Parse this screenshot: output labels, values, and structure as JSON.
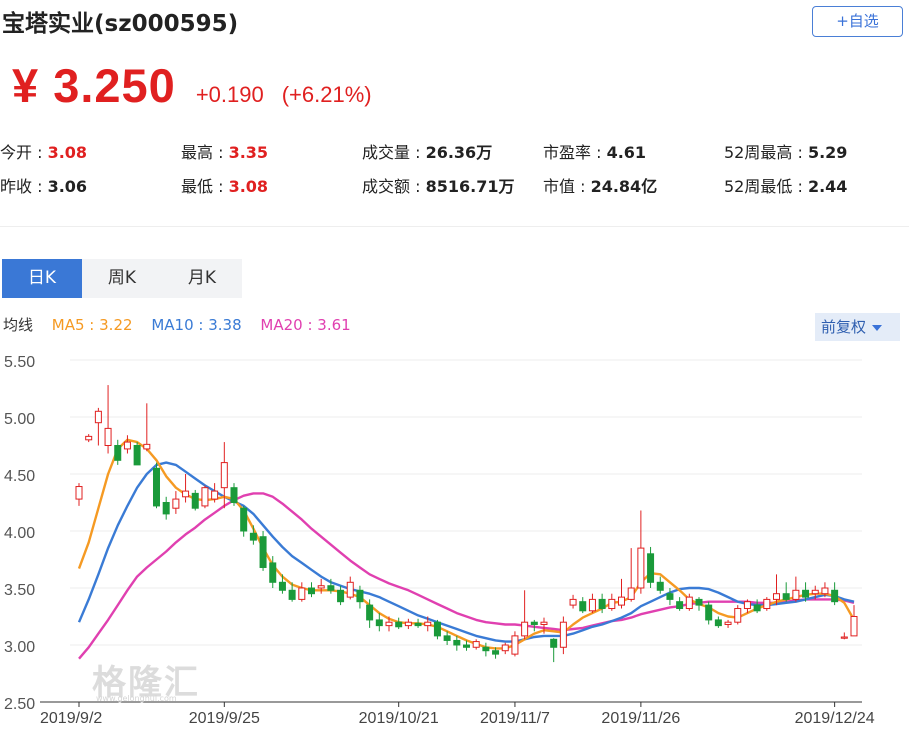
{
  "header": {
    "title": "宝塔实业(sz000595)",
    "watch_label": "+自选"
  },
  "quote": {
    "price": "¥ 3.250",
    "change": "+0.190",
    "change_pct": "(+6.21%)"
  },
  "stats": [
    {
      "label": "今开 : ",
      "value": "3.08",
      "red": true
    },
    {
      "label": "最高 : ",
      "value": "3.35",
      "red": true
    },
    {
      "label": "成交量 : ",
      "value": "26.36万",
      "red": false
    },
    {
      "label": "市盈率 : ",
      "value": "4.61",
      "red": false
    },
    {
      "label": "52周最高 : ",
      "value": "5.29",
      "red": false
    },
    {
      "label": "昨收 : ",
      "value": "3.06",
      "red": false
    },
    {
      "label": "最低 : ",
      "value": "3.08",
      "red": true
    },
    {
      "label": "成交额 : ",
      "value": "8516.71万",
      "red": false
    },
    {
      "label": "市值 : ",
      "value": "24.84亿",
      "red": false
    },
    {
      "label": "52周最低 : ",
      "value": "2.44",
      "red": false
    }
  ],
  "tabs": [
    {
      "label": "日K",
      "active": true
    },
    {
      "label": "周K",
      "active": false
    },
    {
      "label": "月K",
      "active": false
    }
  ],
  "legend": {
    "label": "均线",
    "ma5": "MA5 : 3.22",
    "ma10": "MA10 : 3.38",
    "ma20": "MA20 : 3.61"
  },
  "adjust_label": "前复权",
  "watermark": "格隆汇",
  "watermark_sub": "www.gelonghui.com",
  "colors": {
    "up": "#e02020",
    "down": "#1a9a3a",
    "ma5": "#f59a23",
    "ma10": "#3a7bd5",
    "ma20": "#e040b0",
    "accent": "#3a78d6"
  },
  "chart_data": {
    "type": "candlestick",
    "ylim": [
      2.5,
      5.5
    ],
    "yticks": [
      "5.50",
      "5.00",
      "4.50",
      "4.00",
      "3.50",
      "3.00",
      "2.50"
    ],
    "xticks": [
      {
        "index": 0,
        "label": "2019/9/2"
      },
      {
        "index": 15,
        "label": "2019/9/25"
      },
      {
        "index": 33,
        "label": "2019/10/21"
      },
      {
        "index": 45,
        "label": "2019/11/7"
      },
      {
        "index": 58,
        "label": "2019/11/26"
      },
      {
        "index": 78,
        "label": "2019/12/24"
      }
    ],
    "candles": [
      [
        4.28,
        4.39,
        4.22,
        4.42
      ],
      [
        4.8,
        4.83,
        4.78,
        4.85
      ],
      [
        4.95,
        5.05,
        4.75,
        5.08
      ],
      [
        4.75,
        4.9,
        4.68,
        5.28
      ],
      [
        4.75,
        4.62,
        4.58,
        4.8
      ],
      [
        4.72,
        4.78,
        4.68,
        4.84
      ],
      [
        4.75,
        4.58,
        4.58,
        4.78
      ],
      [
        4.72,
        4.76,
        4.7,
        5.12
      ],
      [
        4.55,
        4.22,
        4.2,
        4.6
      ],
      [
        4.25,
        4.15,
        4.1,
        4.3
      ],
      [
        4.2,
        4.28,
        4.15,
        4.35
      ],
      [
        4.3,
        4.35,
        4.25,
        4.5
      ],
      [
        4.33,
        4.2,
        4.18,
        4.36
      ],
      [
        4.22,
        4.38,
        4.2,
        4.4
      ],
      [
        4.28,
        4.35,
        4.25,
        4.42
      ],
      [
        4.38,
        4.6,
        4.2,
        4.78
      ],
      [
        4.38,
        4.25,
        4.22,
        4.42
      ],
      [
        4.2,
        4.0,
        3.95,
        4.22
      ],
      [
        3.98,
        3.92,
        3.88,
        4.05
      ],
      [
        3.95,
        3.68,
        3.65,
        4.0
      ],
      [
        3.72,
        3.55,
        3.5,
        3.78
      ],
      [
        3.55,
        3.48,
        3.45,
        3.62
      ],
      [
        3.48,
        3.4,
        3.38,
        3.55
      ],
      [
        3.4,
        3.5,
        3.38,
        3.55
      ],
      [
        3.5,
        3.45,
        3.42,
        3.55
      ],
      [
        3.5,
        3.52,
        3.45,
        3.58
      ],
      [
        3.52,
        3.48,
        3.45,
        3.58
      ],
      [
        3.48,
        3.38,
        3.35,
        3.52
      ],
      [
        3.42,
        3.55,
        3.4,
        3.6
      ],
      [
        3.48,
        3.38,
        3.32,
        3.52
      ],
      [
        3.35,
        3.22,
        3.15,
        3.4
      ],
      [
        3.22,
        3.17,
        3.12,
        3.28
      ],
      [
        3.17,
        3.2,
        3.12,
        3.25
      ],
      [
        3.2,
        3.16,
        3.14,
        3.24
      ],
      [
        3.17,
        3.2,
        3.14,
        3.23
      ],
      [
        3.19,
        3.17,
        3.15,
        3.23
      ],
      [
        3.17,
        3.2,
        3.12,
        3.25
      ],
      [
        3.2,
        3.08,
        3.05,
        3.22
      ],
      [
        3.08,
        3.04,
        3.0,
        3.12
      ],
      [
        3.04,
        3.0,
        2.95,
        3.08
      ],
      [
        3.0,
        2.98,
        2.95,
        3.04
      ],
      [
        2.98,
        3.03,
        2.96,
        3.05
      ],
      [
        2.98,
        2.95,
        2.9,
        3.02
      ],
      [
        2.95,
        2.92,
        2.88,
        2.98
      ],
      [
        2.95,
        3.0,
        2.92,
        3.02
      ],
      [
        2.92,
        3.08,
        2.9,
        3.12
      ],
      [
        3.08,
        3.2,
        3.05,
        3.48
      ],
      [
        3.2,
        3.18,
        3.12,
        3.22
      ],
      [
        3.18,
        3.2,
        3.1,
        3.24
      ],
      [
        3.05,
        2.98,
        2.85,
        3.06
      ],
      [
        2.98,
        3.2,
        2.92,
        3.25
      ],
      [
        3.35,
        3.4,
        3.32,
        3.44
      ],
      [
        3.38,
        3.3,
        3.28,
        3.42
      ],
      [
        3.3,
        3.4,
        3.28,
        3.45
      ],
      [
        3.4,
        3.32,
        3.28,
        3.45
      ],
      [
        3.32,
        3.4,
        3.3,
        3.45
      ],
      [
        3.35,
        3.42,
        3.32,
        3.58
      ],
      [
        3.4,
        3.5,
        3.38,
        3.85
      ],
      [
        3.5,
        3.85,
        3.45,
        4.18
      ],
      [
        3.8,
        3.55,
        3.5,
        3.86
      ],
      [
        3.55,
        3.48,
        3.45,
        3.6
      ],
      [
        3.45,
        3.4,
        3.35,
        3.5
      ],
      [
        3.38,
        3.32,
        3.3,
        3.42
      ],
      [
        3.32,
        3.42,
        3.3,
        3.45
      ],
      [
        3.4,
        3.35,
        3.3,
        3.42
      ],
      [
        3.35,
        3.22,
        3.18,
        3.38
      ],
      [
        3.22,
        3.17,
        3.15,
        3.25
      ],
      [
        3.18,
        3.2,
        3.15,
        3.22
      ],
      [
        3.2,
        3.32,
        3.18,
        3.35
      ],
      [
        3.32,
        3.38,
        3.28,
        3.4
      ],
      [
        3.35,
        3.3,
        3.28,
        3.4
      ],
      [
        3.32,
        3.4,
        3.3,
        3.42
      ],
      [
        3.4,
        3.45,
        3.35,
        3.62
      ],
      [
        3.45,
        3.4,
        3.38,
        3.55
      ],
      [
        3.4,
        3.48,
        3.38,
        3.6
      ],
      [
        3.48,
        3.42,
        3.38,
        3.55
      ],
      [
        3.45,
        3.48,
        3.4,
        3.52
      ],
      [
        3.45,
        3.5,
        3.42,
        3.55
      ],
      [
        3.48,
        3.38,
        3.35,
        3.55
      ],
      [
        3.06,
        3.07,
        3.05,
        3.11
      ],
      [
        3.08,
        3.25,
        3.08,
        3.35
      ]
    ],
    "ma5": [
      3.67,
      3.9,
      4.2,
      4.5,
      4.72,
      4.8,
      4.78,
      4.72,
      4.62,
      4.48,
      4.38,
      4.32,
      4.28,
      4.27,
      4.28,
      4.3,
      4.28,
      4.18,
      4.02,
      3.85,
      3.7,
      3.6,
      3.53,
      3.5,
      3.48,
      3.48,
      3.48,
      3.47,
      3.45,
      3.42,
      3.35,
      3.28,
      3.23,
      3.2,
      3.19,
      3.19,
      3.18,
      3.16,
      3.12,
      3.08,
      3.04,
      3.01,
      2.98,
      2.97,
      2.97,
      3.0,
      3.05,
      3.1,
      3.13,
      3.12,
      3.11,
      3.18,
      3.24,
      3.28,
      3.32,
      3.37,
      3.38,
      3.42,
      3.55,
      3.63,
      3.62,
      3.55,
      3.48,
      3.4,
      3.36,
      3.33,
      3.28,
      3.25,
      3.24,
      3.28,
      3.32,
      3.35,
      3.38,
      3.4,
      3.42,
      3.44,
      3.45,
      3.45,
      3.43,
      3.37,
      3.22
    ],
    "ma10": [
      3.2,
      3.4,
      3.62,
      3.85,
      4.05,
      4.22,
      4.38,
      4.5,
      4.58,
      4.6,
      4.58,
      4.52,
      4.46,
      4.4,
      4.35,
      4.3,
      4.26,
      4.22,
      4.15,
      4.05,
      3.95,
      3.86,
      3.78,
      3.72,
      3.66,
      3.6,
      3.55,
      3.52,
      3.49,
      3.47,
      3.45,
      3.42,
      3.38,
      3.34,
      3.3,
      3.26,
      3.23,
      3.2,
      3.17,
      3.14,
      3.11,
      3.08,
      3.06,
      3.04,
      3.03,
      3.03,
      3.05,
      3.07,
      3.08,
      3.08,
      3.08,
      3.1,
      3.13,
      3.16,
      3.18,
      3.21,
      3.24,
      3.28,
      3.34,
      3.38,
      3.42,
      3.46,
      3.49,
      3.5,
      3.5,
      3.49,
      3.46,
      3.42,
      3.38,
      3.36,
      3.35,
      3.35,
      3.36,
      3.37,
      3.38,
      3.4,
      3.42,
      3.44,
      3.43,
      3.4,
      3.38
    ],
    "ma20": [
      2.88,
      2.98,
      3.1,
      3.22,
      3.35,
      3.48,
      3.6,
      3.68,
      3.75,
      3.82,
      3.9,
      3.97,
      4.03,
      4.1,
      4.16,
      4.22,
      4.27,
      4.31,
      4.33,
      4.33,
      4.3,
      4.24,
      4.17,
      4.1,
      4.02,
      3.95,
      3.88,
      3.81,
      3.74,
      3.68,
      3.62,
      3.58,
      3.54,
      3.51,
      3.48,
      3.44,
      3.4,
      3.36,
      3.32,
      3.28,
      3.25,
      3.22,
      3.2,
      3.19,
      3.18,
      3.18,
      3.17,
      3.16,
      3.15,
      3.14,
      3.13,
      3.14,
      3.15,
      3.17,
      3.19,
      3.21,
      3.22,
      3.24,
      3.27,
      3.29,
      3.31,
      3.33,
      3.34,
      3.36,
      3.37,
      3.38,
      3.38,
      3.38,
      3.38,
      3.38,
      3.37,
      3.37,
      3.37,
      3.38,
      3.39,
      3.4,
      3.4,
      3.4,
      3.4,
      3.39,
      3.37
    ]
  }
}
